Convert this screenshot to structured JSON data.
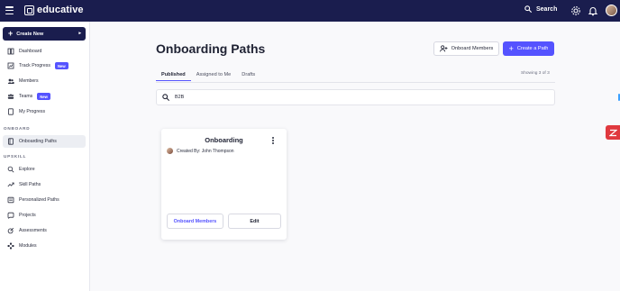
{
  "header": {
    "logo_text": "educative",
    "search_label": "Search"
  },
  "sidebar": {
    "create_new_label": "Create New",
    "items_top": [
      {
        "label": "Dashboard",
        "icon": "dashboard-icon"
      },
      {
        "label": "Track Progress",
        "icon": "track-progress-icon",
        "badge": "New"
      },
      {
        "label": "Members",
        "icon": "members-icon"
      },
      {
        "label": "Teams",
        "icon": "teams-icon",
        "badge": "New"
      },
      {
        "label": "My Progress",
        "icon": "my-progress-icon"
      }
    ],
    "section_onboard": "ONBOARD",
    "onboard_items": [
      {
        "label": "Onboarding Paths",
        "icon": "onboarding-paths-icon",
        "active": true
      }
    ],
    "section_upskill": "UPSKILL",
    "upskill_items": [
      {
        "label": "Explore",
        "icon": "explore-icon"
      },
      {
        "label": "Skill Paths",
        "icon": "skill-paths-icon"
      },
      {
        "label": "Personalized Paths",
        "icon": "personalized-paths-icon"
      },
      {
        "label": "Projects",
        "icon": "projects-icon"
      },
      {
        "label": "Assessments",
        "icon": "assessments-icon"
      },
      {
        "label": "Modules",
        "icon": "modules-icon"
      }
    ]
  },
  "main": {
    "title": "Onboarding Paths",
    "onboard_members_label": "Onboard Members",
    "create_path_label": "Create a Path",
    "tabs": [
      {
        "label": "Published",
        "active": true
      },
      {
        "label": "Assigned to Me",
        "active": false
      },
      {
        "label": "Drafts",
        "active": false
      }
    ],
    "showing_text": "Showing 3 of 3",
    "search": {
      "value": "B2B",
      "placeholder": ""
    },
    "cards": [
      {
        "title": "Onboarding",
        "author": "Created By: John Thompson",
        "onboard_label": "Onboard Members",
        "edit_label": "Edit"
      }
    ]
  },
  "colors": {
    "header_bg": "#1a1d4e",
    "accent": "#5553ff",
    "zendesk": "#e0393e"
  }
}
